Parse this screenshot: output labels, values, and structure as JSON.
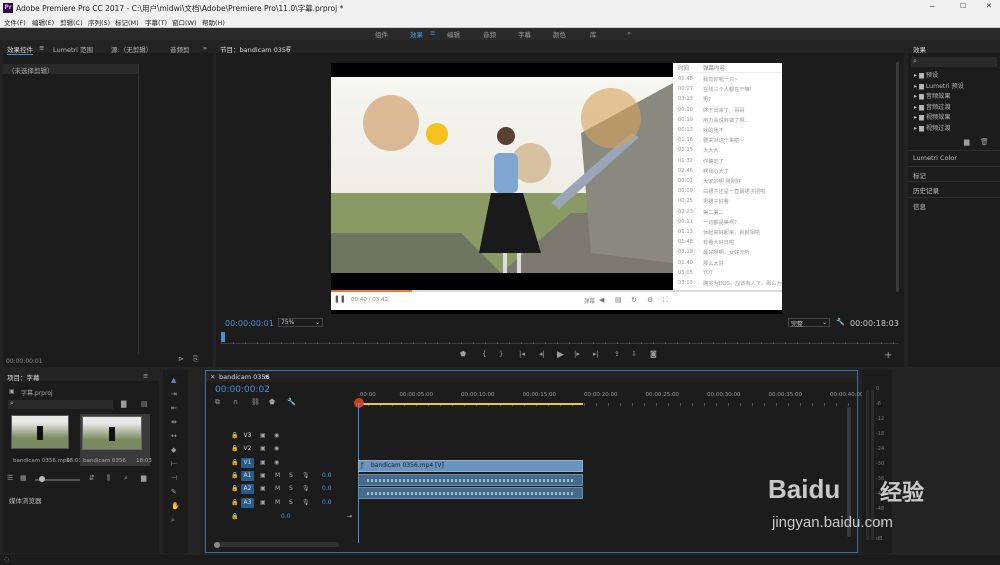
{
  "window": {
    "title": "Adobe Premiere Pro CC 2017 - C:\\用户\\midwi\\文档\\Adobe\\Premiere Pro\\11.0\\字幕.prproj *",
    "app_icon": "Pr"
  },
  "menu": [
    "文件(F)",
    "编辑(E)",
    "剪辑(C)",
    "序列(S)",
    "标记(M)",
    "字幕(T)",
    "窗口(W)",
    "帮助(H)"
  ],
  "workspaces": {
    "items": [
      "组件",
      "效果",
      "编辑",
      "音频",
      "字幕",
      "颜色",
      "库"
    ],
    "active": "效果",
    "more": "»"
  },
  "left_panel": {
    "tabs": [
      "效果控件",
      "Lumetri 范围",
      "源:（无剪辑）",
      "音频剪"
    ],
    "more": "»",
    "no_clip": "（未选择剪辑）",
    "timecode": "00:00:00:01"
  },
  "program": {
    "title": "节目：bandicam 0356",
    "timecode": "00:00:00:01",
    "zoom": "75%",
    "quality": "完整",
    "duration": "00:00:18:03",
    "player": {
      "time": "00:40 / 03:42",
      "danmaku_label": "弹幕"
    },
    "danmaku_header": [
      "时间",
      "弹幕内容"
    ],
    "danmaku": [
      [
        "01:48",
        "我觉你唱一只~"
      ],
      [
        "00:07",
        "在线三个人都在干嘛!"
      ],
      [
        "03:23",
        "男?"
      ],
      [
        "00:10",
        "终于出来了。哥哥"
      ],
      [
        "00:19",
        "用力会说好做了啊..."
      ],
      [
        "00:13",
        "就的我不"
      ],
      [
        "01:16",
        "要来对这个来吧~"
      ],
      [
        "01:15",
        "大大大"
      ],
      [
        "01:32",
        "你确定了"
      ],
      [
        "02:46",
        "啊我心大了"
      ],
      [
        "00:01",
        "大家的啊 刚刚好"
      ],
      [
        "00:09",
        "白裙子还是一直最裙子把啦"
      ],
      [
        "00:25",
        "男裙子好看"
      ],
      [
        "02:23",
        "第二第二"
      ],
      [
        "00:11",
        "一切都是美啊?"
      ],
      [
        "01:13",
        "休起来好起来，就就相啦"
      ],
      [
        "01:48",
        "有看大好日啦"
      ],
      [
        "03:19",
        "最好啊啊，女好无听"
      ],
      [
        "01:40",
        "那么太好"
      ],
      [
        "03:05",
        "YO?"
      ],
      [
        "03:03",
        "确实为DOS，应该有人了，那么为"
      ]
    ]
  },
  "right_panel": {
    "title": "效果",
    "search_icon": "⌕",
    "tree": [
      "预设",
      "Lumetri 预设",
      "音频效果",
      "音频过渡",
      "视频效果",
      "视频过渡"
    ],
    "sections": [
      "Lumetri Color",
      "标记",
      "历史记录",
      "信息"
    ]
  },
  "project": {
    "title": "项目：字幕",
    "more": "≡",
    "file": "字幕.prproj",
    "clips": [
      {
        "name": "bandicam 0356.mp4",
        "dur": "18:03"
      },
      {
        "name": "bandicam 0356",
        "dur": "18:03"
      }
    ],
    "media_browser": "媒体浏览器"
  },
  "timeline": {
    "title": "bandicam 0356",
    "timecode": "00:00:00:02",
    "ruler": [
      ":00:00",
      "00:00:05:00",
      "00:00:10:00",
      "00:00:15:00",
      "00:00:20:00",
      "00:00:25:00",
      "00:00:30:00",
      "00:00:35:00",
      "00:00:40:00"
    ],
    "video_tracks": [
      "V3",
      "V2",
      "V1"
    ],
    "audio_tracks": [
      "A1",
      "A2",
      "A3"
    ],
    "audio_level": "0.0",
    "master_level": "0.0",
    "clip_label": "bandicam 0356.mp4 [V]",
    "meter_scale": [
      "0",
      "-6",
      "-12",
      "-18",
      "-24",
      "-30",
      "-36",
      "-42",
      "-48",
      "-54",
      "dB"
    ]
  },
  "watermark": {
    "brand": "Baidu",
    "cn": "经验",
    "url": "jingyan.baidu.com"
  },
  "colors": {
    "accent": "#4a90d6",
    "playhead": "#e8c840",
    "clip": "#6a95c0"
  }
}
